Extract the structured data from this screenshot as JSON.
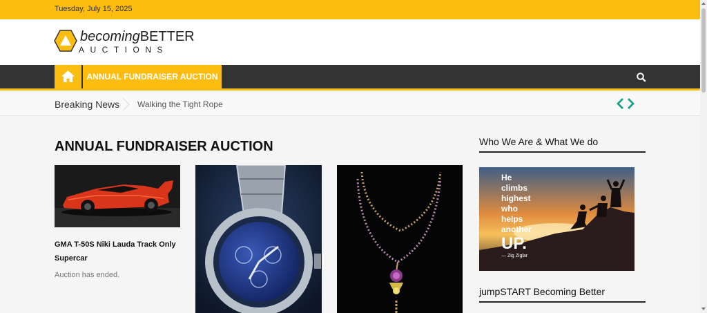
{
  "topbar": {
    "date": "Tuesday, July 15, 2025"
  },
  "logo": {
    "word1": "becoming",
    "word2": "BETTER",
    "word3": "AUCTIONS"
  },
  "nav": {
    "home_icon": "home-icon",
    "items": [
      {
        "label": "ANNUAL FUNDRAISER AUCTION"
      }
    ],
    "search_icon": "search-icon"
  },
  "breaking": {
    "label": "Breaking News",
    "item": "Walking the Tight Rope",
    "prev_icon": "chevron-left-icon",
    "next_icon": "chevron-right-icon"
  },
  "main": {
    "section_title": "ANNUAL FUNDRAISER AUCTION",
    "cards": [
      {
        "title_line1": "GMA T-50S Niki Lauda Track Only",
        "title_line2": "Supercar",
        "status": "Auction has ended."
      },
      {
        "title_line1": "",
        "status": ""
      },
      {
        "title_line1": "",
        "status": ""
      }
    ]
  },
  "sidebar": {
    "widgets": [
      {
        "title": "Who We Are & What We do"
      },
      {
        "title": "jumpSTART Becoming Better"
      }
    ],
    "quote": {
      "lines": [
        "He",
        "climbs",
        "highest",
        "who",
        "helps",
        "another"
      ],
      "emphasis": "UP.",
      "author": "— Zig Ziglar"
    }
  },
  "colors": {
    "accent": "#fdbd10",
    "nav_bg": "#333333",
    "arrow": "#1aa087"
  }
}
